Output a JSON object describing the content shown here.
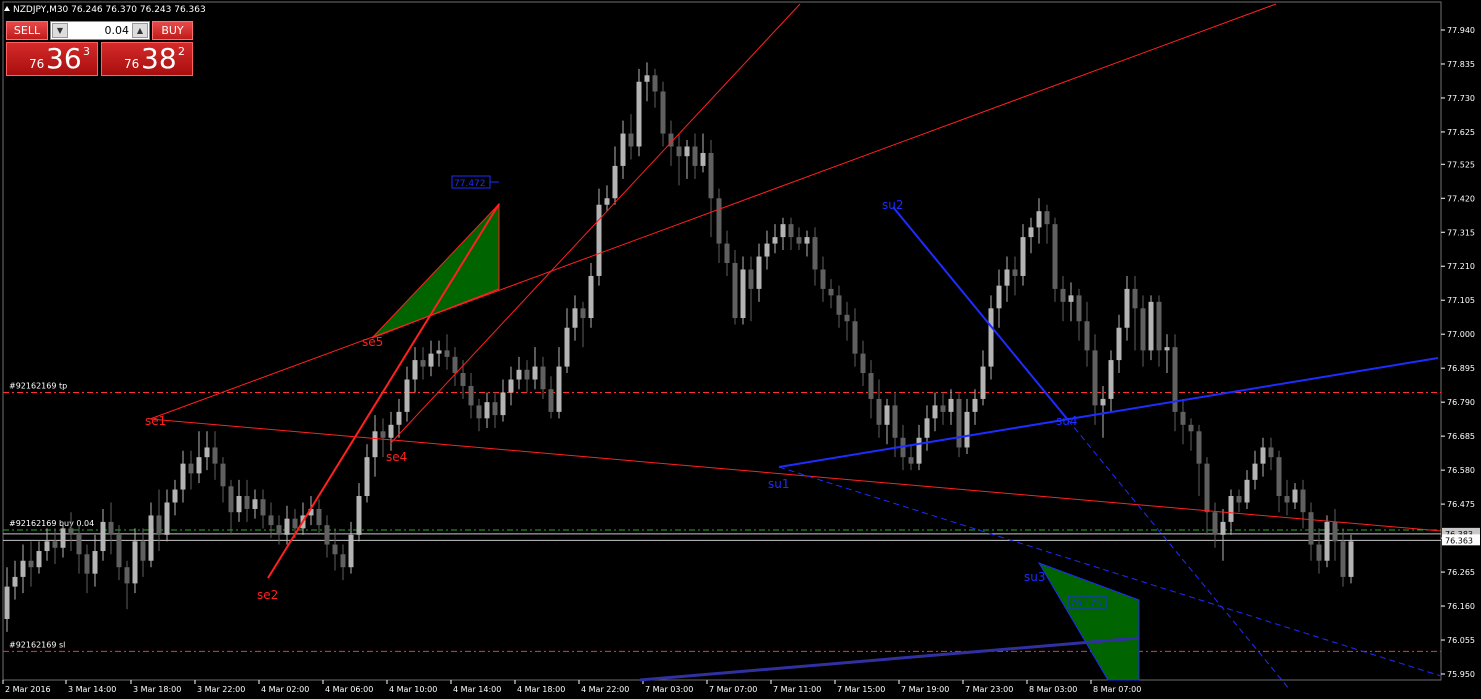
{
  "title": {
    "symbol_tf": "NZDJPY,M30",
    "ohlc": "76.246 76.370 76.243 76.363"
  },
  "trade_panel": {
    "sell_label": "SELL",
    "buy_label": "BUY",
    "lot": "0.04",
    "sell_price": {
      "prefix": "76",
      "big": "36",
      "sup": "3"
    },
    "buy_price": {
      "prefix": "76",
      "big": "38",
      "sup": "2"
    }
  },
  "colors": {
    "bull": "#b4b4b4",
    "bear": "#606060",
    "grid": "#707070",
    "axis_text": "#ffffff",
    "red": "#ff2020",
    "blue": "#1e2cff",
    "fill_green": "#006400",
    "tp_sl": "#ff3030",
    "entry": "#20b020"
  },
  "chart_data": {
    "type": "candlestick",
    "symbol": "NZDJPY",
    "timeframe": "M30",
    "ylim": [
      75.95,
      77.98
    ],
    "y_ticks": [
      "77.940",
      "77.835",
      "77.730",
      "77.625",
      "77.525",
      "77.420",
      "77.315",
      "77.210",
      "77.105",
      "77.000",
      "76.895",
      "76.790",
      "76.685",
      "76.580",
      "76.475",
      "76.370",
      "76.265",
      "76.160",
      "76.055",
      "75.950"
    ],
    "x_labels": [
      "2 Mar 2016",
      "3 Mar 14:00",
      "3 Mar 18:00",
      "3 Mar 22:00",
      "4 Mar 02:00",
      "4 Mar 06:00",
      "4 Mar 10:00",
      "4 Mar 14:00",
      "4 Mar 18:00",
      "4 Mar 22:00",
      "7 Mar 03:00",
      "7 Mar 07:00",
      "7 Mar 11:00",
      "7 Mar 15:00",
      "7 Mar 19:00",
      "7 Mar 23:00",
      "8 Mar 03:00",
      "8 Mar 07:00"
    ],
    "current_price": "76.363",
    "ask_tag": "76.383",
    "candles": [
      [
        76.12,
        76.22,
        76.08,
        76.28
      ],
      [
        76.22,
        76.25,
        76.18,
        76.3
      ],
      [
        76.25,
        76.3,
        76.2,
        76.35
      ],
      [
        76.3,
        76.28,
        76.22,
        76.36
      ],
      [
        76.28,
        76.33,
        76.26,
        76.36
      ],
      [
        76.33,
        76.36,
        76.3,
        76.4
      ],
      [
        76.36,
        76.34,
        76.29,
        76.4
      ],
      [
        76.34,
        76.4,
        76.31,
        76.42
      ],
      [
        76.4,
        76.38,
        76.33,
        76.45
      ],
      [
        76.38,
        76.32,
        76.26,
        76.41
      ],
      [
        76.32,
        76.26,
        76.2,
        76.35
      ],
      [
        76.26,
        76.33,
        76.22,
        76.38
      ],
      [
        76.33,
        76.42,
        76.3,
        76.46
      ],
      [
        76.42,
        76.38,
        76.32,
        76.48
      ],
      [
        76.38,
        76.28,
        76.24,
        76.41
      ],
      [
        76.28,
        76.23,
        76.15,
        76.3
      ],
      [
        76.23,
        76.36,
        76.2,
        76.4
      ],
      [
        76.36,
        76.3,
        76.25,
        76.4
      ],
      [
        76.3,
        76.44,
        76.28,
        76.48
      ],
      [
        76.44,
        76.38,
        76.33,
        76.52
      ],
      [
        76.38,
        76.48,
        76.36,
        76.52
      ],
      [
        76.48,
        76.52,
        76.44,
        76.55
      ],
      [
        76.52,
        76.6,
        76.48,
        76.64
      ],
      [
        76.6,
        76.57,
        76.52,
        76.64
      ],
      [
        76.57,
        76.62,
        76.54,
        76.7
      ],
      [
        76.62,
        76.65,
        76.58,
        76.7
      ],
      [
        76.65,
        76.6,
        76.55,
        76.7
      ],
      [
        76.6,
        76.53,
        76.48,
        76.62
      ],
      [
        76.53,
        76.45,
        76.38,
        76.55
      ],
      [
        76.45,
        76.5,
        76.42,
        76.55
      ],
      [
        76.5,
        76.46,
        76.42,
        76.55
      ],
      [
        76.46,
        76.49,
        76.43,
        76.52
      ],
      [
        76.49,
        76.44,
        76.4,
        76.52
      ],
      [
        76.44,
        76.41,
        76.37,
        76.48
      ],
      [
        76.41,
        76.38,
        76.35,
        76.44
      ],
      [
        76.38,
        76.43,
        76.35,
        76.47
      ],
      [
        76.43,
        76.4,
        76.37,
        76.46
      ],
      [
        76.4,
        76.44,
        76.38,
        76.48
      ],
      [
        76.44,
        76.46,
        76.41,
        76.5
      ],
      [
        76.46,
        76.41,
        76.38,
        76.49
      ],
      [
        76.41,
        76.35,
        76.31,
        76.44
      ],
      [
        76.35,
        76.32,
        76.27,
        76.4
      ],
      [
        76.32,
        76.28,
        76.24,
        76.35
      ],
      [
        76.28,
        76.38,
        76.26,
        76.42
      ],
      [
        76.38,
        76.5,
        76.36,
        76.54
      ],
      [
        76.5,
        76.62,
        76.48,
        76.66
      ],
      [
        76.62,
        76.7,
        76.56,
        76.75
      ],
      [
        76.7,
        76.68,
        76.62,
        76.74
      ],
      [
        76.68,
        76.72,
        76.64,
        76.76
      ],
      [
        76.72,
        76.76,
        76.68,
        76.8
      ],
      [
        76.76,
        76.86,
        76.73,
        76.9
      ],
      [
        76.86,
        76.92,
        76.82,
        76.96
      ],
      [
        76.92,
        76.9,
        76.86,
        76.96
      ],
      [
        76.9,
        76.94,
        76.87,
        76.98
      ],
      [
        76.94,
        76.95,
        76.9,
        76.98
      ],
      [
        76.95,
        76.93,
        76.89,
        77.0
      ],
      [
        76.93,
        76.88,
        76.84,
        76.96
      ],
      [
        76.88,
        76.84,
        76.8,
        76.92
      ],
      [
        76.84,
        76.78,
        76.74,
        76.88
      ],
      [
        76.78,
        76.74,
        76.7,
        76.8
      ],
      [
        76.74,
        76.79,
        76.71,
        76.82
      ],
      [
        76.79,
        76.75,
        76.71,
        76.82
      ],
      [
        76.75,
        76.82,
        76.73,
        76.86
      ],
      [
        76.82,
        76.86,
        76.78,
        76.9
      ],
      [
        76.86,
        76.89,
        76.83,
        76.93
      ],
      [
        76.89,
        76.86,
        76.82,
        76.92
      ],
      [
        76.86,
        76.9,
        76.83,
        76.96
      ],
      [
        76.9,
        76.83,
        76.8,
        76.93
      ],
      [
        76.83,
        76.76,
        76.74,
        76.87
      ],
      [
        76.76,
        76.9,
        76.74,
        76.96
      ],
      [
        76.9,
        77.02,
        76.88,
        77.08
      ],
      [
        77.02,
        77.08,
        76.98,
        77.12
      ],
      [
        77.08,
        77.05,
        76.96,
        77.1
      ],
      [
        77.05,
        77.18,
        77.02,
        77.22
      ],
      [
        77.18,
        77.4,
        77.15,
        77.45
      ],
      [
        77.4,
        77.42,
        77.38,
        77.46
      ],
      [
        77.42,
        77.52,
        77.4,
        77.58
      ],
      [
        77.52,
        77.62,
        77.48,
        77.66
      ],
      [
        77.62,
        77.58,
        77.54,
        77.68
      ],
      [
        77.58,
        77.78,
        77.55,
        77.82
      ],
      [
        77.78,
        77.8,
        77.72,
        77.84
      ],
      [
        77.8,
        77.75,
        77.7,
        77.82
      ],
      [
        77.75,
        77.62,
        77.58,
        77.78
      ],
      [
        77.62,
        77.58,
        77.52,
        77.66
      ],
      [
        77.58,
        77.55,
        77.46,
        77.62
      ],
      [
        77.55,
        77.58,
        77.48,
        77.6
      ],
      [
        77.58,
        77.52,
        77.48,
        77.62
      ],
      [
        77.52,
        77.56,
        77.5,
        77.62
      ],
      [
        77.56,
        77.42,
        77.3,
        77.6
      ],
      [
        77.42,
        77.28,
        77.22,
        77.45
      ],
      [
        77.28,
        77.22,
        77.18,
        77.32
      ],
      [
        77.22,
        77.05,
        77.03,
        77.26
      ],
      [
        77.05,
        77.2,
        77.03,
        77.24
      ],
      [
        77.2,
        77.14,
        77.04,
        77.24
      ],
      [
        77.14,
        77.24,
        77.1,
        77.28
      ],
      [
        77.24,
        77.28,
        77.2,
        77.32
      ],
      [
        77.28,
        77.3,
        77.25,
        77.34
      ],
      [
        77.3,
        77.34,
        77.26,
        77.36
      ],
      [
        77.34,
        77.3,
        77.26,
        77.36
      ],
      [
        77.3,
        77.28,
        77.26,
        77.33
      ],
      [
        77.28,
        77.3,
        77.24,
        77.32
      ],
      [
        77.3,
        77.2,
        77.15,
        77.33
      ],
      [
        77.2,
        77.14,
        77.1,
        77.24
      ],
      [
        77.14,
        77.12,
        77.08,
        77.17
      ],
      [
        77.12,
        77.06,
        77.02,
        77.15
      ],
      [
        77.06,
        77.04,
        76.98,
        77.1
      ],
      [
        77.04,
        76.94,
        76.9,
        77.08
      ],
      [
        76.94,
        76.88,
        76.84,
        76.98
      ],
      [
        76.88,
        76.8,
        76.74,
        76.92
      ],
      [
        76.8,
        76.72,
        76.68,
        76.86
      ],
      [
        76.72,
        76.78,
        76.66,
        76.8
      ],
      [
        76.78,
        76.68,
        76.62,
        76.82
      ],
      [
        76.68,
        76.62,
        76.58,
        76.72
      ],
      [
        76.62,
        76.6,
        76.58,
        76.66
      ],
      [
        76.6,
        76.68,
        76.58,
        76.72
      ],
      [
        76.68,
        76.74,
        76.64,
        76.78
      ],
      [
        76.74,
        76.78,
        76.7,
        76.82
      ],
      [
        76.78,
        76.76,
        76.72,
        76.82
      ],
      [
        76.76,
        76.8,
        76.72,
        76.83
      ],
      [
        76.8,
        76.65,
        76.62,
        76.82
      ],
      [
        76.65,
        76.76,
        76.63,
        76.8
      ],
      [
        76.76,
        76.8,
        76.72,
        76.83
      ],
      [
        76.8,
        76.9,
        76.78,
        76.95
      ],
      [
        76.9,
        77.08,
        76.86,
        77.12
      ],
      [
        77.08,
        77.15,
        77.02,
        77.2
      ],
      [
        77.15,
        77.2,
        77.1,
        77.24
      ],
      [
        77.2,
        77.18,
        77.12,
        77.24
      ],
      [
        77.18,
        77.3,
        77.15,
        77.34
      ],
      [
        77.3,
        77.33,
        77.25,
        77.36
      ],
      [
        77.33,
        77.38,
        77.28,
        77.42
      ],
      [
        77.38,
        77.34,
        77.28,
        77.4
      ],
      [
        77.34,
        77.14,
        77.1,
        77.36
      ],
      [
        77.14,
        77.1,
        77.04,
        77.18
      ],
      [
        77.1,
        77.12,
        77.04,
        77.16
      ],
      [
        77.12,
        77.04,
        76.98,
        77.14
      ],
      [
        77.04,
        76.95,
        76.9,
        77.1
      ],
      [
        76.95,
        76.78,
        76.72,
        77.0
      ],
      [
        76.78,
        76.8,
        76.68,
        76.84
      ],
      [
        76.8,
        76.92,
        76.76,
        76.95
      ],
      [
        76.92,
        77.02,
        76.88,
        77.06
      ],
      [
        77.02,
        77.14,
        76.98,
        77.18
      ],
      [
        77.14,
        77.08,
        76.95,
        77.18
      ],
      [
        77.08,
        76.95,
        76.9,
        77.12
      ],
      [
        76.95,
        77.1,
        76.92,
        77.12
      ],
      [
        77.1,
        76.95,
        76.9,
        77.12
      ],
      [
        76.95,
        76.96,
        76.88,
        77.0
      ],
      [
        76.96,
        76.76,
        76.7,
        77.0
      ],
      [
        76.76,
        76.72,
        76.66,
        76.8
      ],
      [
        76.72,
        76.7,
        76.64,
        76.74
      ],
      [
        76.7,
        76.6,
        76.5,
        76.72
      ],
      [
        76.6,
        76.45,
        76.38,
        76.62
      ],
      [
        76.45,
        76.38,
        76.34,
        76.48
      ],
      [
        76.38,
        76.42,
        76.3,
        76.46
      ],
      [
        76.42,
        76.5,
        76.38,
        76.52
      ],
      [
        76.5,
        76.48,
        76.45,
        76.52
      ],
      [
        76.48,
        76.55,
        76.46,
        76.58
      ],
      [
        76.55,
        76.6,
        76.52,
        76.64
      ],
      [
        76.6,
        76.65,
        76.56,
        76.68
      ],
      [
        76.65,
        76.62,
        76.58,
        76.68
      ],
      [
        76.62,
        76.5,
        76.45,
        76.64
      ],
      [
        76.5,
        76.48,
        76.44,
        76.55
      ],
      [
        76.48,
        76.52,
        76.46,
        76.54
      ],
      [
        76.52,
        76.45,
        76.4,
        76.55
      ],
      [
        76.45,
        76.35,
        76.3,
        76.48
      ],
      [
        76.35,
        76.3,
        76.26,
        76.4
      ],
      [
        76.3,
        76.42,
        76.28,
        76.44
      ],
      [
        76.42,
        76.36,
        76.3,
        76.46
      ],
      [
        76.36,
        76.25,
        76.22,
        76.4
      ],
      [
        76.25,
        76.36,
        76.23,
        76.38
      ]
    ],
    "trend_line_labels_red": [
      "se1",
      "se2",
      "se4",
      "se5"
    ],
    "trend_line_labels_blue": [
      "su1",
      "su2",
      "su3",
      "su4"
    ],
    "price_boxes": [
      "77.472",
      "76.175"
    ],
    "hline_labels": {
      "tp": "#92162169 tp",
      "entry": "#92162169 buy 0.04",
      "sl": "#92162169 sl"
    },
    "hline_values": {
      "tp": 76.82,
      "entry": 76.395,
      "sl": 76.02
    }
  }
}
